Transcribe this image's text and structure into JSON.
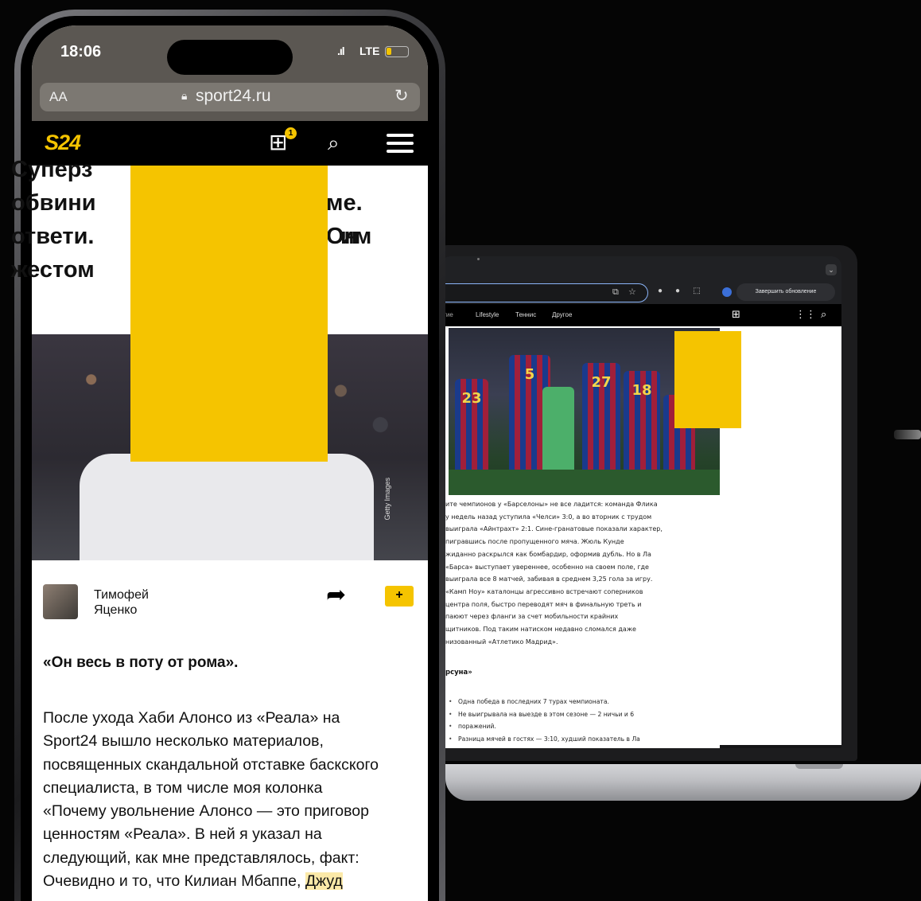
{
  "phone": {
    "status": {
      "time": "18:06",
      "network": "LTE"
    },
    "browser": {
      "aa_label": "AA",
      "url": "sport24.ru"
    },
    "site": {
      "logo": "S24",
      "gift_badge": "1"
    },
    "article": {
      "headline_lines": [
        "Суперз",
        "обвини",
        "ме. Он",
        "ответи.",
        "им",
        "жестом"
      ],
      "photo_credit": "Getty Images",
      "author": {
        "first_name": "Тимофей",
        "last_name": "Яценко"
      },
      "bookmark_label": "+",
      "subheading": "«Он весь в поту от рома».",
      "body_lines": [
        "После ухода Хаби Алонсо из «Реала» на",
        "Sport24 вышло несколько материалов,",
        "посвященных скандальной отставке баскского",
        "специалиста, в том числе моя колонка",
        "«Почему увольнение Алонсо — это приговор",
        "ценностям «Реала». В ней я указал на",
        "следующий, как мне представлялось, факт:",
        "Очевидно и то, что Килиан Мбаппе,"
      ],
      "body_highlight": "Джуд"
    }
  },
  "laptop": {
    "browser": {
      "update_button": "Завершить обновление"
    },
    "nav": [
      "Lifestyle",
      "Теннис",
      "Другое"
    ],
    "nav_partial": "гие",
    "article_lines": [
      "ите чемпионов у «Барселоны» не все ладится: команда Флика",
      "у недель назад уступила «Челси» 3:0, а во вторник с трудом",
      "выиграла «Айнтрахт» 2:1. Сине-гранатовые показали характер,",
      "пигравшись после пропущенного мяча. Жюль Кунде",
      "жиданно раскрылся как бомбардир, оформив дубль. Но в Ла",
      "«Барса» выступает увереннее, особенно на своем поле, где",
      "выиграла все 8 матчей, забивая в среднем 3,25 гола за игру.",
      "«Камп Ноу» каталонцы агрессивно встречают соперников",
      "центра поля, быстро переводят мяч в финальную треть и",
      "паюют через фланги за счет мобильности крайних",
      "щитников. Под таким натиском недавно сломался даже",
      "низованный «Атлетико Мадрид»."
    ],
    "subheading": "рсуна»",
    "list": [
      "Одна победа в последних 7 турах чемпионата.",
      "Не выигрывала на выезде в этом сезоне — 2 ничьи и 6",
      "поражений.",
      "Разница мячей в гостях — 3:10, худший показатель в Ла"
    ],
    "jerseys": [
      "23",
      "5",
      "27",
      "18"
    ]
  },
  "colors": {
    "accent": "#f5c400",
    "background": "#050505"
  }
}
